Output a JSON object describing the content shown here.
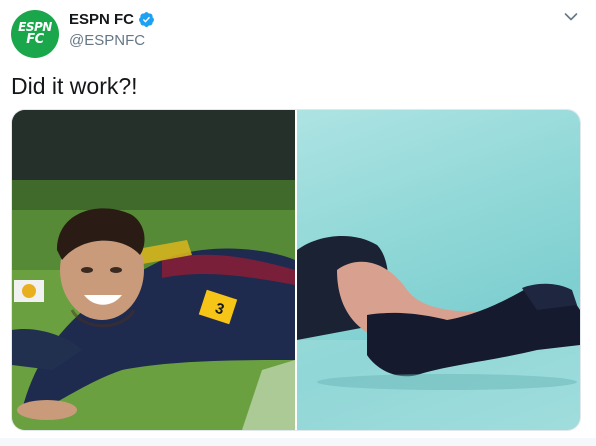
{
  "account": {
    "avatar_line1": "ESPN",
    "avatar_line2": "FC",
    "display_name": "ESPN FC",
    "handle": "@ESPNFC",
    "verified": true,
    "verified_icon": "verified-badge-icon"
  },
  "tweet": {
    "text": "Did it work?!"
  },
  "media": {
    "left_image_description": "",
    "right_image_description": "",
    "jersey_patch_text": "3"
  },
  "colors": {
    "brand_green": "#1aa64a",
    "verified_blue": "#1da1f2",
    "secondary_text": "#657786"
  },
  "icons": {
    "more": "chevron-down-icon"
  }
}
